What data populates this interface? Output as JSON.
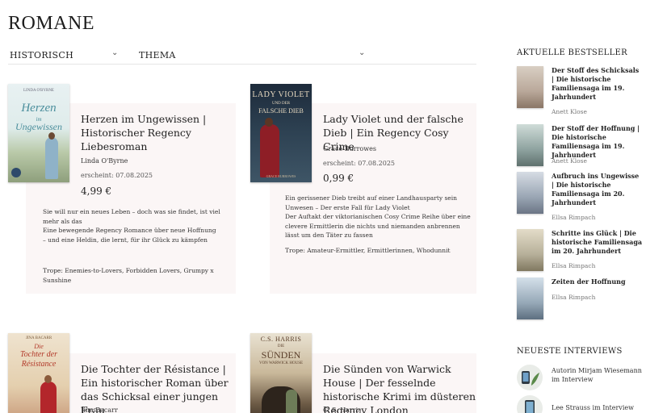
{
  "page": {
    "title": "ROMANE"
  },
  "filters": [
    {
      "label": "HISTORISCH",
      "chevron": "chevron-down-icon"
    },
    {
      "label": "THEMA",
      "chevron": "chevron-down-icon"
    }
  ],
  "books": [
    {
      "title": "Herzen im Ungewissen | Historischer Regency Liebesroman",
      "author": "Linda O'Byrne",
      "date": "erscheint: 07.08.2025",
      "price": "4,99 €",
      "description": "Sie will nur ein neues Leben – doch was sie findet, ist viel mehr als das\nEine bewegende Regency Romance über neue Hoffnung – und eine Heldin, die lernt, für ihr Glück zu kämpfen",
      "trope": "Trope: Enemies-to-Lovers, Forbidden Lovers, Grumpy x Sunshine",
      "cover_author": "LINDA O'BYRNE",
      "cover_title_1": "Herzen",
      "cover_title_2": "im",
      "cover_title_3": "Ungewissen"
    },
    {
      "title": "Lady Violet und der falsche Dieb | Ein Regency Cosy Crime",
      "author": "Grace Burrowes",
      "date": "erscheint: 07.08.2025",
      "price": "0,99 €",
      "description": "Ein gerissener Dieb treibt auf einer Landhausparty sein Unwesen – Der erste Fall für Lady Violet\nDer Auftakt der viktorianischen Cosy Crime Reihe über eine clevere Ermittlerin die nichts und niemanden anbrennen lässt um den Täter zu fassen",
      "trope": "Trope: Amateur-Ermittler, Ermittlerinnen, Whodunnit",
      "cover_author": "",
      "cover_title_1": "LADY VIOLET",
      "cover_title_2": "UND DER",
      "cover_title_3": "FALSCHE DIEB",
      "cover_bottom": "GRACE BURROWES"
    },
    {
      "title": "Die Tochter der Résistance | Ein historischer Roman über das Schicksal einer jungen Frau",
      "author": "Jina Bacarr",
      "cover_author": "JINA BACARR",
      "cover_title_1": "Die",
      "cover_title_2": "Tochter der",
      "cover_title_3": "Résistance"
    },
    {
      "title": "Die Sünden von Warwick House | Der fesselnde historische Krimi im düsteren Regency London",
      "author": "C. S. Harris",
      "cover_author": "C.S. HARRIS",
      "cover_title_1": "DIE",
      "cover_title_2": "SÜNDEN",
      "cover_title_3": "VON WARWICK HOUSE"
    }
  ],
  "sidebar": {
    "bestseller_heading": "AKTUELLE BESTSELLER",
    "bestsellers": [
      {
        "title": "Der Stoff des Schicksals | Die historische Familiensaga im 19. Jahrhundert",
        "author": "Anett Klose",
        "color": "#b9a89a"
      },
      {
        "title": "Der Stoff der Hoffnung | Die historische Familiensaga im 19. Jahrhundert",
        "author": "Anett Klose",
        "color": "#8fa3a0"
      },
      {
        "title": "Aufbruch ins Ungewisse | Die historische Familiensaga im 20. Jahrhundert",
        "author": "Ellsa Rimpach",
        "color": "#9aa6b4"
      },
      {
        "title": "Schritte ins Glück | Die historische Familiensaga im 20. Jahrhundert",
        "author": "Ellsa Rimpach",
        "color": "#b7b09a"
      },
      {
        "title": "Zeiten der Hoffnung",
        "author": "Ellsa Rimpach",
        "color": "#97a9b8"
      }
    ],
    "interviews_heading": "NEUESTE INTERVIEWS",
    "interviews": [
      {
        "text": "Autorin Mirjam Wiesemann im Interview"
      },
      {
        "text": "Lee Strauss im Interview"
      }
    ]
  }
}
